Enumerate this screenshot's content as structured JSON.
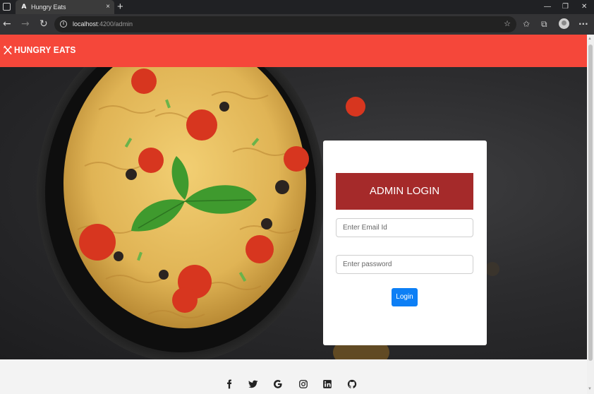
{
  "browser": {
    "tab_favicon": "A",
    "tab_title": "Hungry Eats",
    "tab_close": "×",
    "new_tab": "+",
    "address_host": "localhost",
    "address_path": ":4200/admin",
    "icons": [
      "tab-actions-icon",
      "angular-favicon-icon",
      "back-icon",
      "forward-icon",
      "reload-icon",
      "site-info-icon",
      "add-favorite-icon",
      "favorites-icon",
      "collections-icon",
      "profile-icon",
      "more-icon",
      "minimize-icon",
      "restore-icon",
      "close-icon"
    ]
  },
  "navbar": {
    "brand_name": "HUNGRY EATS",
    "brand_icon": "fork-knife-icon",
    "color": "#f5473a"
  },
  "login": {
    "title": "ADMIN LOGIN",
    "email_placeholder": "Enter Email Id",
    "email_value": "",
    "password_placeholder": "Enter password",
    "password_value": "",
    "button_label": "Login",
    "title_color": "#a52a2a",
    "button_color": "#0d7ff5"
  },
  "footer": {
    "social_icons": [
      "facebook-icon",
      "twitter-icon",
      "google-icon",
      "instagram-icon",
      "linkedin-icon",
      "github-icon"
    ]
  }
}
